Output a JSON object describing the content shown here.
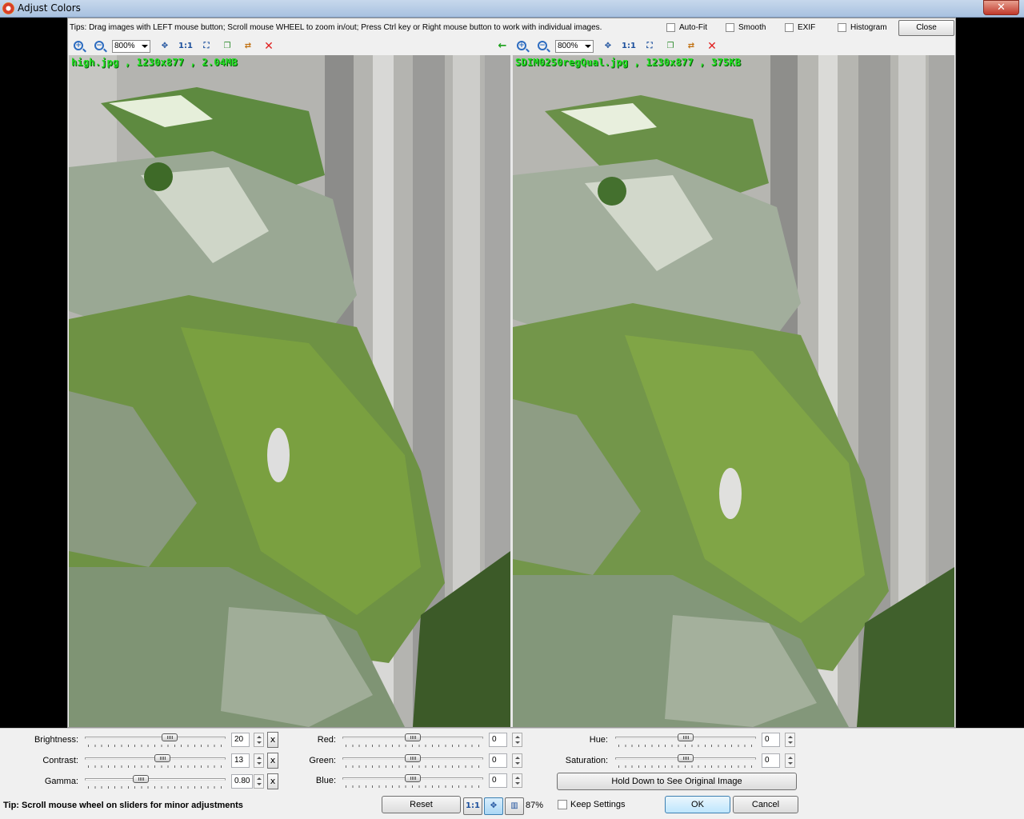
{
  "window": {
    "title": "Adjust Colors",
    "close_glyph": "✕"
  },
  "tips": {
    "text": "Tips: Drag images with LEFT mouse button; Scroll mouse WHEEL to zoom in/out; Press Ctrl key or Right mouse button to work with individual images."
  },
  "options": {
    "autofit": "Auto-Fit",
    "smooth": "Smooth",
    "exif": "EXIF",
    "histogram": "Histogram",
    "close": "Close"
  },
  "left_pane": {
    "zoom": "800%",
    "one_to_one": "1:1",
    "caption": "high.jpg , 1230x877 , 2.04MB",
    "icons": [
      "zoom-in-icon",
      "zoom-out-icon",
      "fit-icon",
      "actual-size-icon",
      "fullscreen-icon",
      "copy-icon",
      "swap-icon",
      "delete-icon",
      "sync-arrow-icon"
    ]
  },
  "right_pane": {
    "zoom": "800%",
    "one_to_one": "1:1",
    "caption": "SDIM0250regQual.jpg , 1230x877 , 375KB"
  },
  "adjust": {
    "brightness": {
      "label": "Brightness:",
      "value": "20",
      "position": 0.6
    },
    "contrast": {
      "label": "Contrast:",
      "value": "13",
      "position": 0.55
    },
    "gamma": {
      "label": "Gamma:",
      "value": "0.80",
      "position": 0.4
    },
    "red": {
      "label": "Red:",
      "value": "0",
      "position": 0.5
    },
    "green": {
      "label": "Green:",
      "value": "0",
      "position": 0.5
    },
    "blue": {
      "label": "Blue:",
      "value": "0",
      "position": 0.5
    },
    "hue": {
      "label": "Hue:",
      "value": "0",
      "position": 0.5
    },
    "saturation": {
      "label": "Saturation:",
      "value": "0",
      "position": 0.5
    },
    "reset_x": "x"
  },
  "footer": {
    "tip": "Tip: Scroll mouse wheel on sliders for minor adjustments",
    "reset": "Reset",
    "one_to_one": "1:1",
    "zoom_percent": "87%",
    "keep_settings": "Keep Settings",
    "hold_original": "Hold Down to See Original Image",
    "ok": "OK",
    "cancel": "Cancel"
  },
  "colors": {
    "caption_green": "#21e021",
    "delete_red": "#e02020",
    "arrow_green": "#1aa01a"
  }
}
